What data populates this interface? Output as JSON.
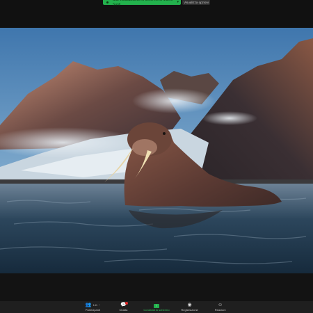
{
  "topbar": {
    "share_status": "Stai visualizzando lo schermo di Marco Santi",
    "options_label": "Visualizza opzioni"
  },
  "toolbar": {
    "participants_label": "Partecipanti",
    "participants_count": "141",
    "chat_label": "Chatta",
    "share_label": "Condividi lo schermo",
    "record_label": "Registrazione",
    "reactions_label": "Reazioni"
  },
  "colors": {
    "share_green": "#23b14d",
    "toolbar_bg": "#1f1f1f",
    "badge_red": "#e02828"
  }
}
